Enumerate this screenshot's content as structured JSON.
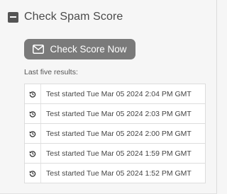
{
  "section": {
    "title": "Check Spam Score"
  },
  "button": {
    "label": "Check Score Now",
    "icon": "envelope-icon"
  },
  "results": {
    "label": "Last five results:",
    "items": [
      "Test started Tue Mar 05 2024 2:04 PM GMT",
      "Test started Tue Mar 05 2024 2:03 PM GMT",
      "Test started Tue Mar 05 2024 2:00 PM GMT",
      "Test started Tue Mar 05 2024 1:59 PM GMT",
      "Test started Tue Mar 05 2024 1:52 PM GMT"
    ],
    "row_icon": "history-icon"
  },
  "colors": {
    "button_bg": "#7a7a7a",
    "collapse_icon": "#555555",
    "panel_bg": "#f6f6f6"
  }
}
